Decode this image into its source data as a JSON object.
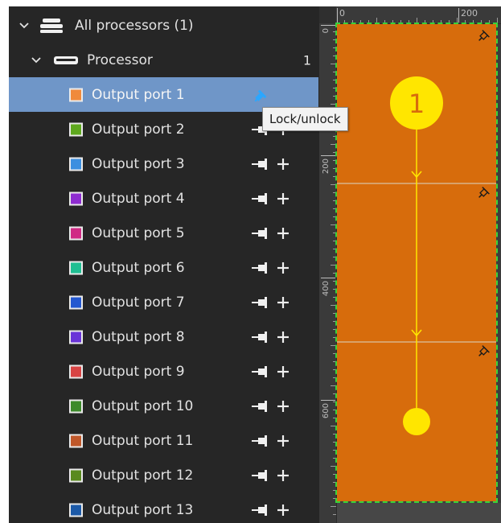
{
  "tree": {
    "root": {
      "label": "All processors (1)"
    },
    "processor": {
      "label": "Processor",
      "count": "1"
    },
    "ports": [
      {
        "label": "Output port 1",
        "color": "#f08a3c",
        "selected": true
      },
      {
        "label": "Output port 2",
        "color": "#5ea81e"
      },
      {
        "label": "Output port 3",
        "color": "#3c8fe0"
      },
      {
        "label": "Output port 4",
        "color": "#8e2cd0"
      },
      {
        "label": "Output port 5",
        "color": "#d02a84"
      },
      {
        "label": "Output port 6",
        "color": "#1fbf92"
      },
      {
        "label": "Output port 7",
        "color": "#2458d0"
      },
      {
        "label": "Output port 8",
        "color": "#6a34d8"
      },
      {
        "label": "Output port 9",
        "color": "#d84444"
      },
      {
        "label": "Output port 10",
        "color": "#3c8a2a"
      },
      {
        "label": "Output port 11",
        "color": "#c0582a"
      },
      {
        "label": "Output port 12",
        "color": "#5a8a1e"
      },
      {
        "label": "Output port 13",
        "color": "#1c5aa8"
      }
    ]
  },
  "tooltip": {
    "text": "Lock/unlock"
  },
  "canvas": {
    "ruler_top": [
      "0",
      "200"
    ],
    "ruler_left": [
      "0",
      "200",
      "400",
      "600"
    ],
    "marker_number": "1",
    "colors": {
      "stage": "#d76c0c",
      "flow": "#ffe600",
      "divider": "#d9b48a",
      "selection": "#37d43a"
    }
  },
  "colors": {
    "sidebar_bg": "#262626",
    "selected_row": "#6f96c8",
    "lock_active": "#2aa7ff",
    "icon_light": "#f0f0f0"
  }
}
